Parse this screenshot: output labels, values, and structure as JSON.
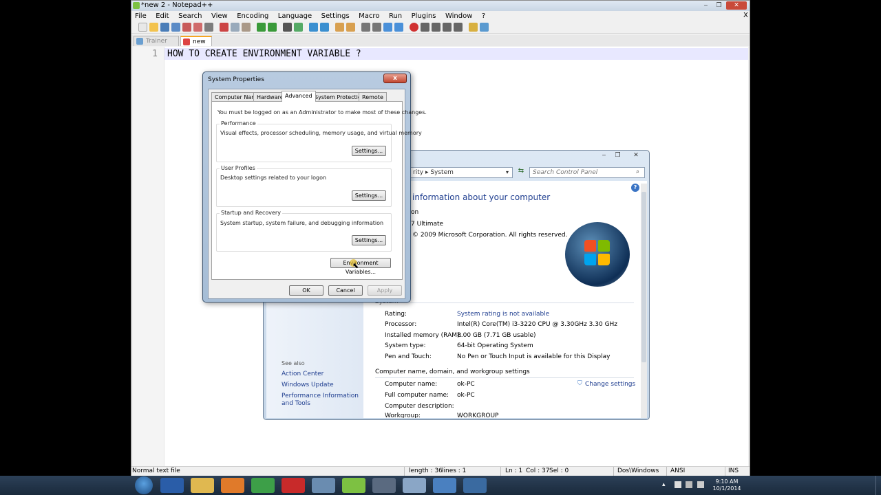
{
  "notepad": {
    "title": "*new  2 - Notepad++",
    "menu": [
      "File",
      "Edit",
      "Search",
      "View",
      "Encoding",
      "Language",
      "Settings",
      "Macro",
      "Run",
      "Plugins",
      "Window",
      "?"
    ],
    "close_x": "X",
    "tabs": [
      {
        "label": "Trainer Tips.txt",
        "active": false
      },
      {
        "label": "new  2",
        "active": true
      }
    ],
    "line_number": "1",
    "line_text": "HOW TO CREATE ENVIRONMENT VARIABLE ?",
    "status": {
      "type": "Normal text file",
      "length": "length : 36",
      "lines": "lines : 1",
      "ln": "Ln : 1",
      "col": "Col : 37",
      "sel": "Sel : 0",
      "eol": "Dos\\Windows",
      "encoding": "ANSI",
      "mode": "INS"
    }
  },
  "control_panel": {
    "breadcrumb_part1": "rity",
    "breadcrumb_part2": "System",
    "search_placeholder": "Search Control Panel",
    "heading": "information about your computer",
    "edition_section": "on",
    "edition": "7 Ultimate",
    "copyright": "© 2009 Microsoft Corporation.  All rights reserved.",
    "system_section": "System",
    "see_also": "See also",
    "nav_links": [
      "Action Center",
      "Windows Update",
      "Performance Information and Tools"
    ],
    "rows": [
      {
        "label": "Rating:",
        "value": "System rating is not available",
        "link": true
      },
      {
        "label": "Processor:",
        "value": "Intel(R) Core(TM) i3-3220 CPU @ 3.30GHz   3.30 GHz",
        "link": false
      },
      {
        "label": "Installed memory (RAM):",
        "value": "8.00 GB (7.71 GB usable)",
        "link": false
      },
      {
        "label": "System type:",
        "value": "64-bit Operating System",
        "link": false
      },
      {
        "label": "Pen and Touch:",
        "value": "No Pen or Touch Input is available for this Display",
        "link": false
      }
    ],
    "name_section": "Computer name, domain, and workgroup settings",
    "change_settings": "Change settings",
    "name_rows": [
      {
        "label": "Computer name:",
        "value": "ok-PC"
      },
      {
        "label": "Full computer name:",
        "value": "ok-PC"
      },
      {
        "label": "Computer description:",
        "value": ""
      },
      {
        "label": "Workgroup:",
        "value": "WORKGROUP"
      }
    ]
  },
  "system_properties": {
    "title": "System Properties",
    "close": "x",
    "tabs": [
      "Computer Name",
      "Hardware",
      "Advanced",
      "System Protection",
      "Remote"
    ],
    "active_tab": "Advanced",
    "admin_note": "You must be logged on as an Administrator to make most of these changes.",
    "performance": {
      "title": "Performance",
      "desc": "Visual effects, processor scheduling, memory usage, and virtual memory",
      "button": "Settings..."
    },
    "user_profiles": {
      "title": "User Profiles",
      "desc": "Desktop settings related to your logon",
      "button": "Settings..."
    },
    "startup": {
      "title": "Startup and Recovery",
      "desc": "System startup, system failure, and debugging information",
      "button": "Settings..."
    },
    "env_button": "Environment Variables...",
    "ok": "OK",
    "cancel": "Cancel",
    "apply": "Apply"
  },
  "taskbar": {
    "time": "9:10 AM",
    "date": "10/1/2014"
  }
}
